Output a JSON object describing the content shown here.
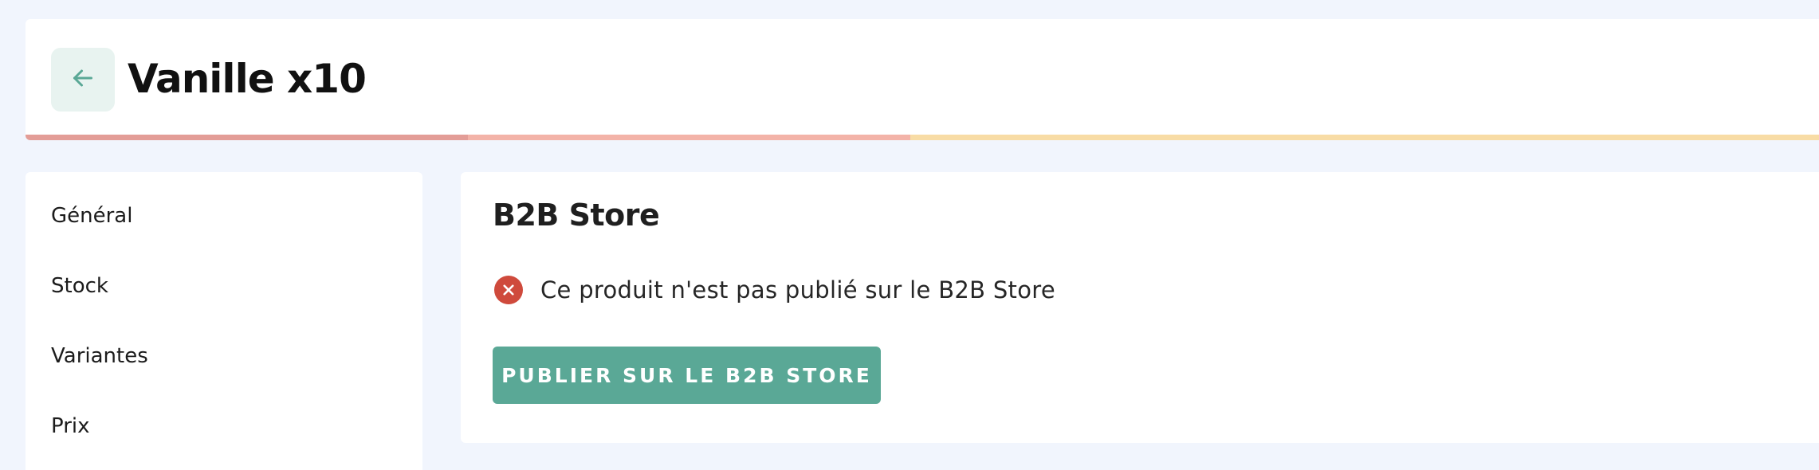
{
  "header": {
    "back_icon": "arrow-left-icon",
    "title": "Vanille x10",
    "progress_colors": [
      "#e39d97",
      "#f3b3a8",
      "#f8dca5"
    ]
  },
  "sidebar": {
    "items": [
      {
        "label": "Général"
      },
      {
        "label": "Stock"
      },
      {
        "label": "Variantes"
      },
      {
        "label": "Prix"
      }
    ]
  },
  "main": {
    "section_title": "B2B Store",
    "status": {
      "icon": "error-x-circle-icon",
      "text": "Ce produit n'est pas publié sur le B2B Store"
    },
    "publish_button_label": "PUBLIER SUR LE B2B STORE"
  },
  "colors": {
    "background": "#f1f5fd",
    "accent": "#5aa896",
    "back_button_bg": "#e8f3f0",
    "error": "#cf4a3c"
  }
}
